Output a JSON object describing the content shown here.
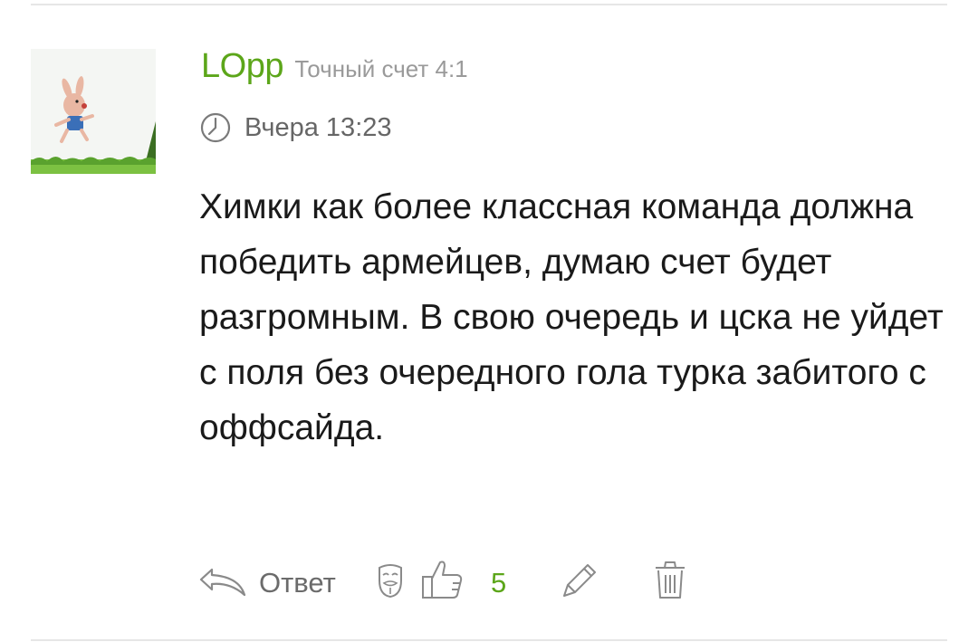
{
  "comment": {
    "author": "LOpp",
    "prediction": "Точный счет 4:1",
    "time": "Вчера 13:23",
    "text": "Химки как более классная команда должна победить армейцев, думаю счет будет разгромным. В свою очередь и цска не уйдет с поля без очередного гола турка забитого с оффсайда."
  },
  "actions": {
    "reply_label": "Ответ",
    "like_count": "5"
  },
  "icons": [
    "clock-icon",
    "reply-icon",
    "anonymous-mask-icon",
    "thumbs-up-icon",
    "pencil-icon",
    "trash-icon"
  ],
  "colors": {
    "username": "#5ca61a",
    "like_count": "#5ca61a",
    "meta_text": "#9a9a9a",
    "icon_stroke": "#8a8a8a",
    "body_text": "#1a1a1a"
  }
}
